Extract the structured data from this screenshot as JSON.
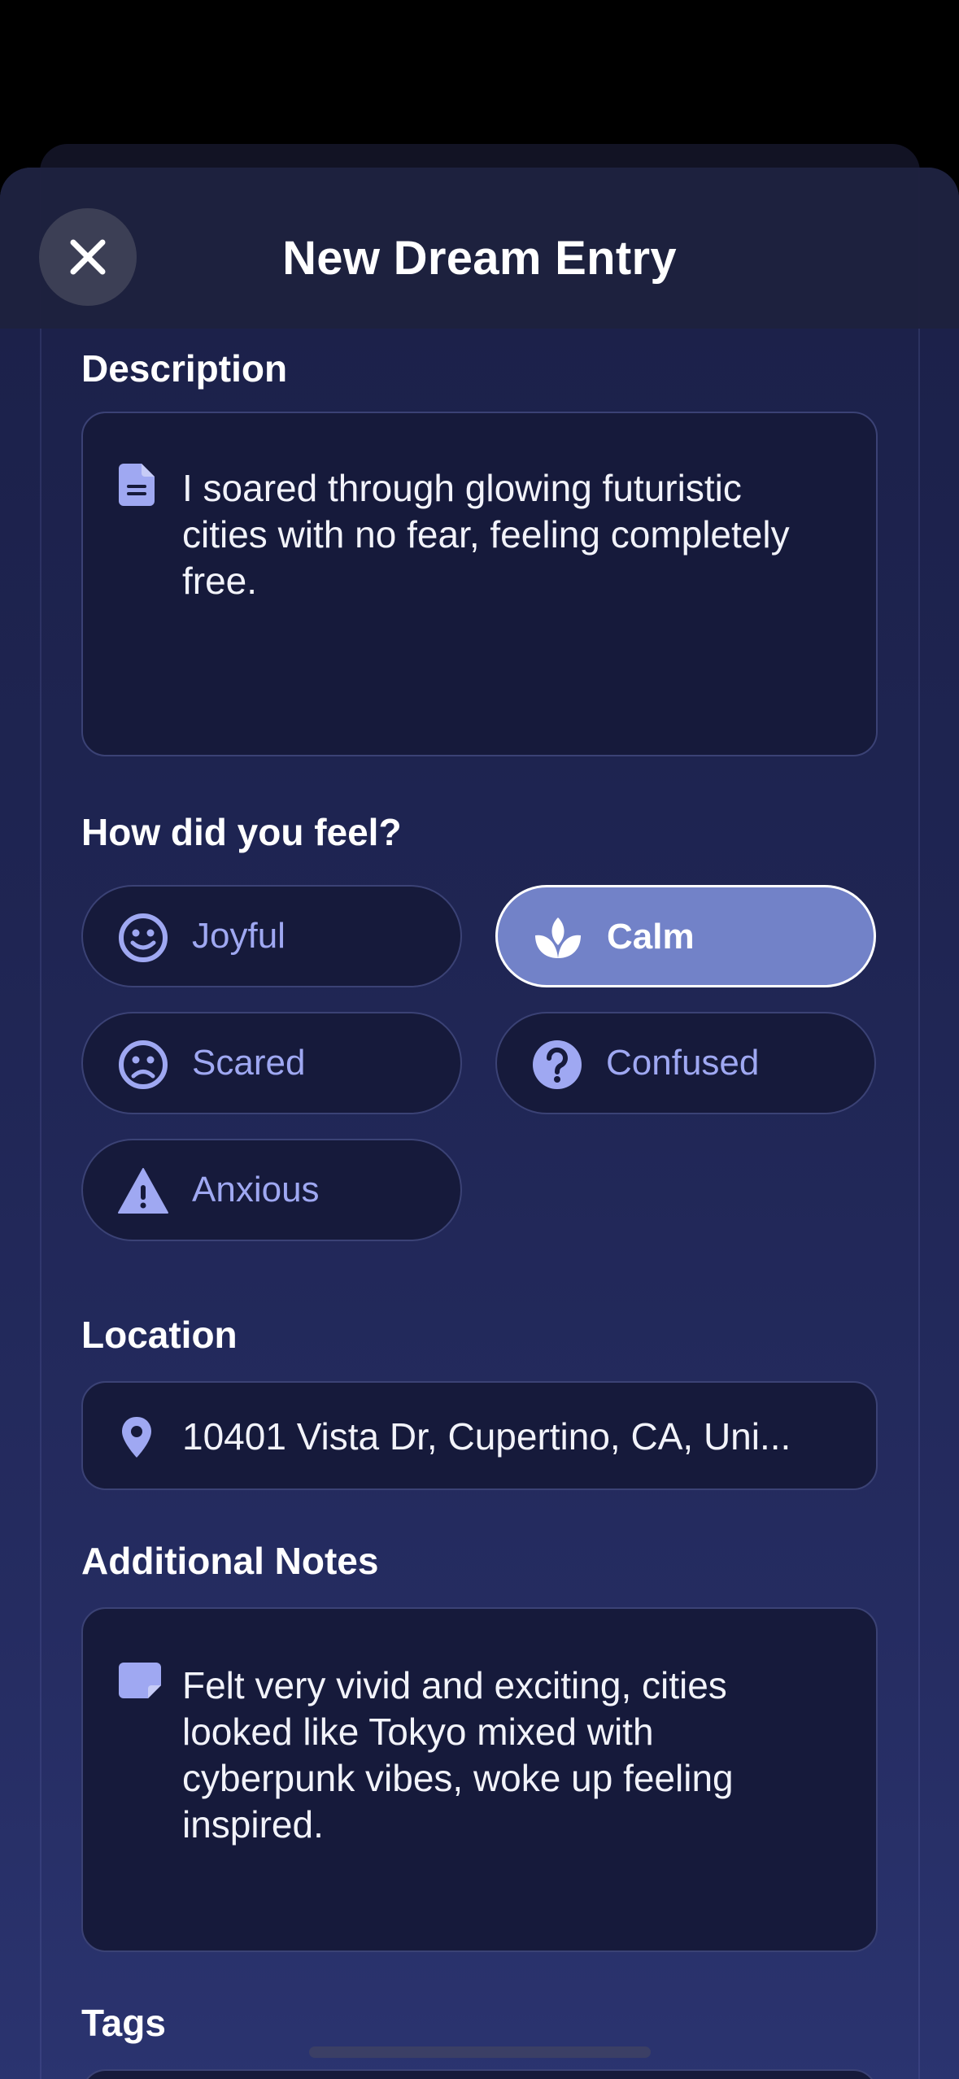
{
  "header": {
    "title": "New Dream Entry"
  },
  "description": {
    "label": "Description",
    "value": "I soared through glowing futuristic cities with no fear, feeling completely free."
  },
  "feelings": {
    "label": "How did you feel?",
    "options": [
      {
        "label": "Joyful",
        "icon": "smile-icon",
        "selected": false
      },
      {
        "label": "Calm",
        "icon": "lotus-icon",
        "selected": true
      },
      {
        "label": "Scared",
        "icon": "frown-icon",
        "selected": false
      },
      {
        "label": "Confused",
        "icon": "question-circle-icon",
        "selected": false
      },
      {
        "label": "Anxious",
        "icon": "warning-triangle-icon",
        "selected": false
      }
    ]
  },
  "location": {
    "label": "Location",
    "value": "10401 Vista Dr, Cupertino, CA, Uni..."
  },
  "notes": {
    "label": "Additional Notes",
    "value": "Felt very vivid and exciting, cities looked like Tokyo mixed with cyberpunk vibes, woke up feeling inspired."
  },
  "tags": {
    "label": "Tags"
  },
  "colors": {
    "accent": "#9fa8f2",
    "selected_chip": "#7282c8",
    "field_bg": "#161a3b",
    "field_border": "#3b4275"
  }
}
